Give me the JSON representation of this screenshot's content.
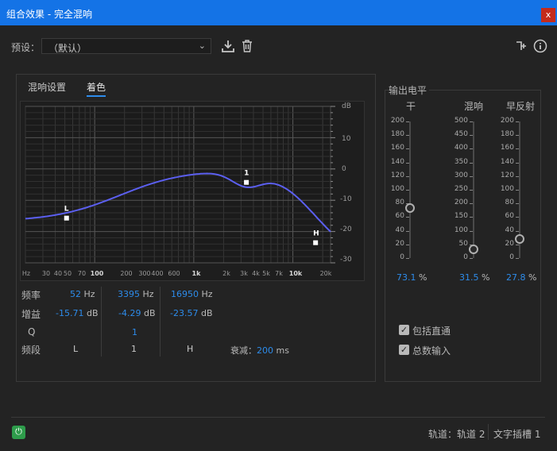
{
  "window": {
    "title": "组合效果 - 完全混响",
    "close_label": "x"
  },
  "preset": {
    "label": "预设：",
    "value": "（默认）",
    "icons": [
      "download-icon",
      "trash-icon",
      "routing-icon",
      "info-icon"
    ]
  },
  "tabs": [
    {
      "label": "混响设置",
      "active": false
    },
    {
      "label": "着色",
      "active": true
    }
  ],
  "graph": {
    "db_unit": "dB",
    "db_ticks": [
      "10",
      "0",
      "-10",
      "-20",
      "-30"
    ],
    "hz_ticks": [
      {
        "label": "Hz",
        "bold": false
      },
      {
        "label": "30",
        "bold": false
      },
      {
        "label": "40",
        "bold": false
      },
      {
        "label": "50",
        "bold": false
      },
      {
        "label": "70",
        "bold": false
      },
      {
        "label": "100",
        "bold": true
      },
      {
        "label": "200",
        "bold": false
      },
      {
        "label": "300",
        "bold": false
      },
      {
        "label": "400",
        "bold": false
      },
      {
        "label": "600",
        "bold": false
      },
      {
        "label": "1k",
        "bold": true
      },
      {
        "label": "2k",
        "bold": false
      },
      {
        "label": "3k",
        "bold": false
      },
      {
        "label": "4k",
        "bold": false
      },
      {
        "label": "5k",
        "bold": false
      },
      {
        "label": "7k",
        "bold": false
      },
      {
        "label": "10k",
        "bold": true
      },
      {
        "label": "20k",
        "bold": false
      }
    ],
    "handles": [
      {
        "label": "L",
        "freq_hz": 52,
        "gain_db": -15.71
      },
      {
        "label": "1",
        "freq_hz": 3395,
        "gain_db": -4.29
      },
      {
        "label": "H",
        "freq_hz": 16950,
        "gain_db": -23.57
      }
    ],
    "curve_color": "#5b5ff0"
  },
  "params": {
    "freq_label": "频率",
    "gain_label": "增益",
    "q_label": "Q",
    "band_label": "频段",
    "hz_unit": "Hz",
    "db_unit": "dB",
    "bands": [
      {
        "freq": "52",
        "gain": "-15.71",
        "q": "",
        "name": "L"
      },
      {
        "freq": "3395",
        "gain": "-4.29",
        "q": "1",
        "name": "1"
      },
      {
        "freq": "16950",
        "gain": "-23.57",
        "q": "",
        "name": "H"
      }
    ],
    "decay_label": "衰减：",
    "decay_value": "200",
    "decay_unit": "ms"
  },
  "output": {
    "title": "输出电平",
    "sliders": [
      {
        "label": "干",
        "scale": [
          "200",
          "180",
          "160",
          "140",
          "120",
          "100",
          "80",
          "60",
          "40",
          "20",
          "0"
        ],
        "max": 200,
        "value": "73.1",
        "unit": "%"
      },
      {
        "label": "混响",
        "scale": [
          "500",
          "450",
          "400",
          "350",
          "300",
          "250",
          "200",
          "150",
          "100",
          "50",
          "0"
        ],
        "max": 500,
        "value": "31.5",
        "unit": "%"
      },
      {
        "label": "早反射",
        "scale": [
          "200",
          "180",
          "160",
          "140",
          "120",
          "100",
          "80",
          "60",
          "40",
          "20",
          "0"
        ],
        "max": 200,
        "value": "27.8",
        "unit": "%"
      }
    ],
    "checkboxes": [
      {
        "label": "包括直通",
        "checked": true
      },
      {
        "label": "总数输入",
        "checked": true
      }
    ]
  },
  "footer": {
    "track": "轨道：轨道 2",
    "slot": "文字插槽 1"
  }
}
